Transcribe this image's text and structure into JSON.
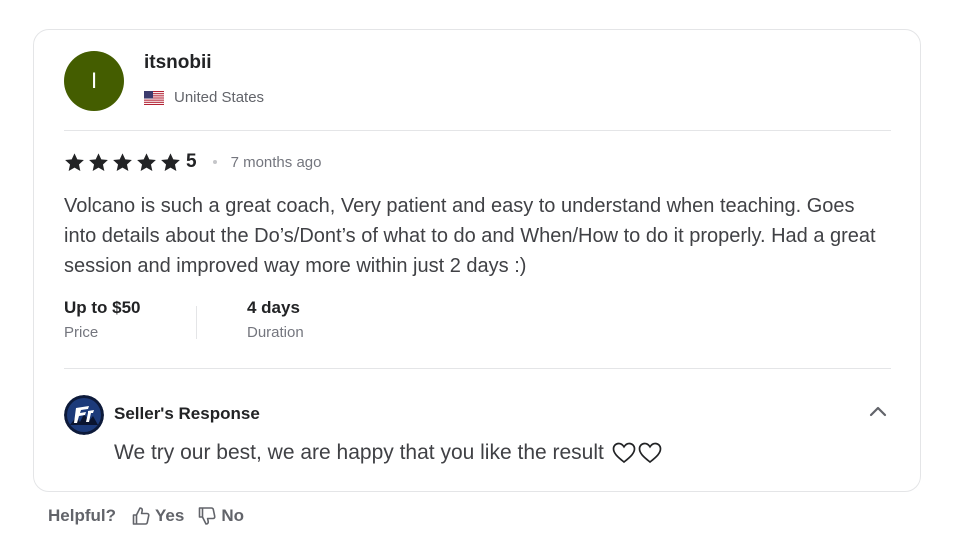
{
  "reviewer": {
    "initial": "I",
    "avatar_color": "#445d00",
    "username": "itsnobii",
    "country": "United States",
    "flag_icon": "us-flag-icon"
  },
  "review": {
    "rating": 5,
    "rating_label": "5",
    "time_ago": "7 months ago",
    "text": "Volcano is such a great coach, Very patient and easy to understand when teaching. Goes into details about the Do’s/Dont’s of what to do and When/How to do it properly. Had a great session and improved way more within just 2 days :)",
    "price": {
      "value": "Up to $50",
      "label": "Price"
    },
    "duration": {
      "value": "4 days",
      "label": "Duration"
    }
  },
  "seller_response": {
    "title": "Seller's Response",
    "logo_icon": "seller-logo-icon",
    "text": "We try our best, we are happy that you like the result",
    "collapse_icon": "chevron-up-icon",
    "trailing_icons": [
      "heart-outline-icon",
      "heart-outline-icon"
    ]
  },
  "helpful": {
    "question": "Helpful?",
    "yes_label": "Yes",
    "no_label": "No"
  },
  "colors": {
    "star": "#222325",
    "text": "#404145",
    "muted": "#74767e",
    "border": "#e4e5e7"
  }
}
